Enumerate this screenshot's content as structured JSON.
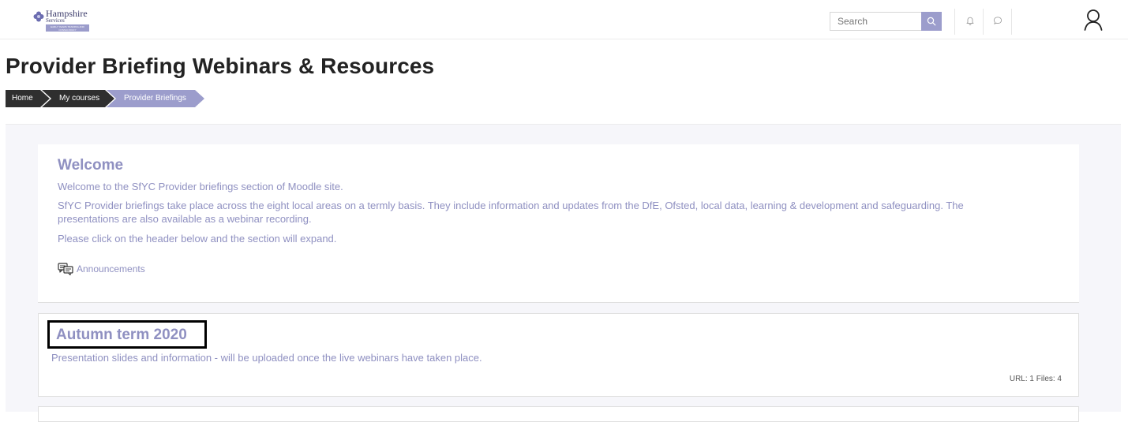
{
  "header": {
    "logo": {
      "title": "Hampshire",
      "subtitle": "Services",
      "band_text": "EARLY YEARS TRAINING AND CONSULTANCY"
    },
    "search": {
      "placeholder": "Search"
    },
    "icons": [
      "search-icon",
      "bell-icon",
      "chat-icon",
      "user-icon"
    ]
  },
  "page": {
    "title": "Provider Briefing Webinars & Resources"
  },
  "breadcrumb": {
    "items": [
      {
        "label": "Home"
      },
      {
        "label": "My courses"
      },
      {
        "label": "Provider Briefings"
      }
    ]
  },
  "welcome": {
    "title": "Welcome",
    "line1": "Welcome to the SfYC Provider briefings section of Moodle site.",
    "line2": "SfYC Provider briefings take place across the eight local areas on a termly basis.  They include information and updates from the DfE, Ofsted, local data, learning & development and safeguarding. The presentations are also available as a webinar recording.",
    "line3": "Please click on the header below and the section will expand.",
    "announcements_label": "Announcements"
  },
  "sections": [
    {
      "title": "Autumn term 2020",
      "description": "Presentation slides and information - will be uploaded once the live webinars have taken place.",
      "meta": "URL: 1  Files: 4"
    }
  ],
  "colors": {
    "accent": "#9c9dcc",
    "accent_text": "#8f90c1",
    "breadcrumb_dark": "#2f2f2f",
    "title_text": "#232323"
  }
}
